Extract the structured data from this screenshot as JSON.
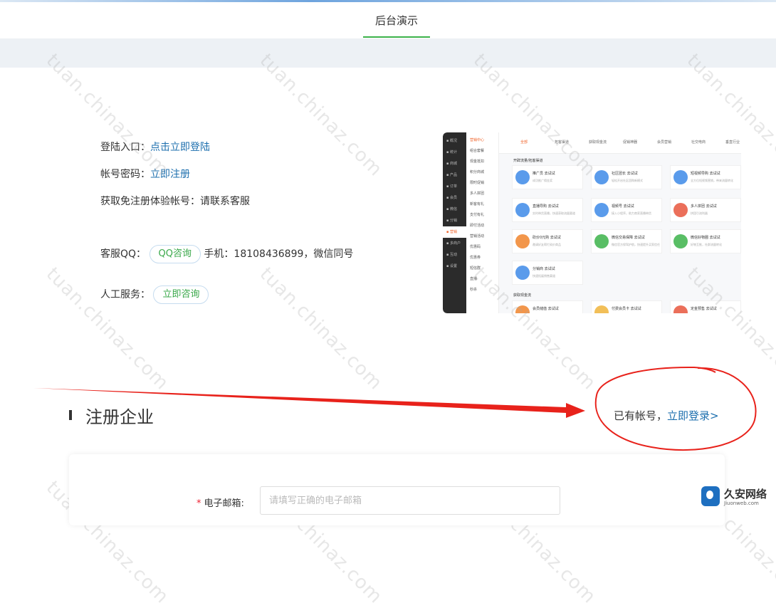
{
  "header": {
    "tab_label": "后台演示"
  },
  "info": {
    "login_label": "登陆入口：",
    "login_link": "点击立即登陆",
    "account_label": "帐号密码：",
    "account_link": "立即注册",
    "trial_text": "获取免注册体验帐号：请联系客服",
    "qq_label": "客服QQ：",
    "qq_button": "QQ咨询",
    "phone_text": "手机：18108436899，微信同号",
    "manual_label": "人工服务：",
    "manual_button": "立即咨询"
  },
  "preview": {
    "sidebar": [
      "概况",
      "统计",
      "商城",
      "产品",
      "订单",
      "会员",
      "微信",
      "分销",
      "营销",
      "多商户",
      "互动",
      "设置"
    ],
    "sidebar_selected": "营销",
    "submenu": [
      "营销中心",
      "组合套餐",
      "现金抵扣",
      "积分商城",
      "限时促销",
      "多人拼团",
      "新客有礼",
      "支付有礼",
      "即付活动",
      "营销活动",
      "优惠码",
      "优惠券",
      "短信群",
      "直播",
      "秒杀"
    ],
    "submenu_selected": "营销中心",
    "tabs": [
      "全部",
      "拓客渠道",
      "获取现金流",
      "促销神器",
      "会员营销",
      "社交电商",
      "垂直行业"
    ],
    "tab_selected": "全部",
    "section1": "开辟流量/拓客渠道",
    "section2": "获取现金流",
    "cards": [
      {
        "title": "推广员",
        "sub": "成功推广佣金奖",
        "color": "#3d8ae8"
      },
      {
        "title": "社区团长",
        "sub": "轻松开启社区团购新模式",
        "color": "#3d8ae8"
      },
      {
        "title": "短视频导购",
        "sub": "全方位短视频营销，带来流量转化",
        "color": "#3d8ae8"
      },
      {
        "title": "直播导购",
        "sub": "实时带货直播，快速获取流量渠道",
        "color": "#3d8ae8"
      },
      {
        "title": "视频号",
        "sub": "接入小程序，助力商家直播带货",
        "color": "#3d8ae8"
      },
      {
        "title": "多人拼团",
        "sub": "拼团引流利器",
        "color": "#e8563d"
      },
      {
        "title": "砍价0元购",
        "sub": "邀请好友帮忙砍价商品",
        "color": "#f0842b"
      },
      {
        "title": "微信交易保障",
        "sub": "微信官方保驾护航，快速提升买家信任",
        "color": "#3cb34a"
      },
      {
        "title": "微信好物圈",
        "sub": "好物互推，社群流量转化",
        "color": "#3cb34a"
      },
      {
        "title": "分销商",
        "sub": "快速拓展销售渠道",
        "color": "#3d8ae8"
      },
      {
        "title": "会员储值",
        "sub": "",
        "color": "#f0842b"
      },
      {
        "title": "付费会员卡",
        "sub": "",
        "color": "#f0b43b"
      },
      {
        "title": "定金预售",
        "sub": "",
        "color": "#e8563d"
      }
    ],
    "card_badge": "去试试"
  },
  "watermark": "tuan.chinaz.com",
  "section": {
    "title": "注册企业",
    "have_account": "已有帐号，",
    "login_link": "立即登录>"
  },
  "form": {
    "email_label": "电子邮箱:",
    "email_placeholder": "请填写正确的电子邮箱"
  },
  "logo": {
    "name": "久安网络",
    "domain": "Jiuonweb.com"
  },
  "colors": {
    "accent_green": "#3cb34a",
    "link_blue": "#1d6fae",
    "annotation_red": "#e8221b"
  }
}
